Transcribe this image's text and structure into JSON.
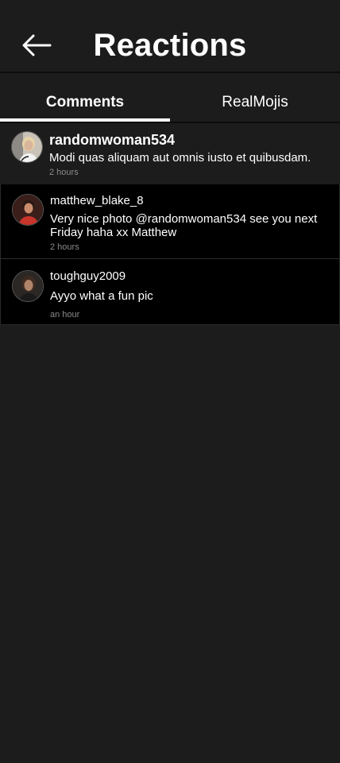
{
  "header": {
    "title": "Reactions",
    "back_icon": "arrow-left-icon"
  },
  "tabs": [
    {
      "label": "Comments",
      "active": true
    },
    {
      "label": "RealMojis",
      "active": false
    }
  ],
  "comments": [
    {
      "username": "randomwoman534",
      "text": "Modi quas aliquam aut omnis iusto et quibusdam.",
      "time": "2 hours"
    },
    {
      "username": "matthew_blake_8",
      "text": "Very nice photo @randomwoman534 see you next Friday haha xx Matthew",
      "time": "2 hours"
    },
    {
      "username": "toughguy2009",
      "text": "Ayyo what a fun pic",
      "time": "an hour"
    }
  ],
  "colors": {
    "background": "#1c1c1c",
    "row_dark": "#000000",
    "text": "#ffffff",
    "muted": "#8a8a8a"
  }
}
